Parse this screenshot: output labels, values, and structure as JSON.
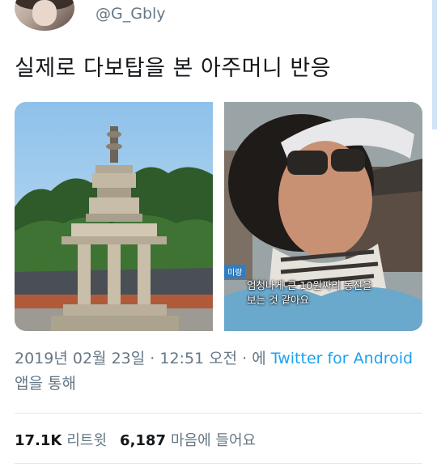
{
  "tweet": {
    "handle": "@G_Gbly",
    "text": "실제로 다보탑을 본 아주머니 반응",
    "media": {
      "caption_line1": "엄청나게 큰 10원짜리 동전을",
      "caption_line2": "보는 것 같아요",
      "name_tag": "미랑"
    },
    "meta": {
      "date": "2019년 02월 23일",
      "sep1": " · ",
      "time": "12:51 오전",
      "sep2": " · 에 ",
      "source": "Twitter for Android",
      "suffix": " 앱을 통해"
    },
    "stats": {
      "retweets": "17.1K",
      "retweets_label": "리트윗",
      "likes": "6,187",
      "likes_label": "마음에 들어요"
    }
  },
  "colors": {
    "link": "#1da1f2",
    "muted": "#657786",
    "text": "#14171a"
  }
}
